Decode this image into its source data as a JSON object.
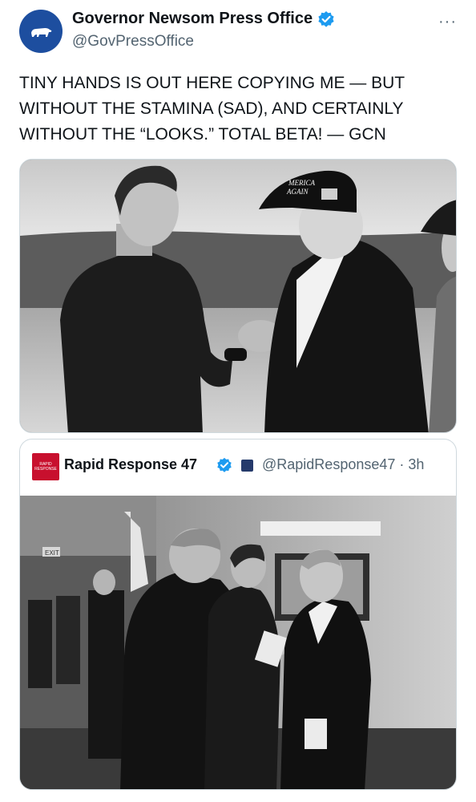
{
  "post": {
    "display_name": "Governor Newsom Press Office",
    "handle": "@GovPressOffice",
    "more_glyph": "···",
    "text": "TINY HANDS IS OUT HERE COPYING ME — BUT\nWITHOUT THE STAMINA (SAD), AND CERTAINLY\nWITHOUT THE “LOOKS.” TOTAL BETA! — GCN",
    "photo_hat_text": "MERICA\nAGAIN"
  },
  "quote": {
    "avatar_text": "RAPID\nRESPONSE",
    "display_name": "Rapid Response 47",
    "handle_time": "@RapidResponse47 · 3h",
    "exit_sign": "EXIT"
  },
  "colors": {
    "verified": "#1d9bf0",
    "avatar_bg": "#1d4e9f",
    "quote_avatar_bg": "#c8102e",
    "text_primary": "#0f1419",
    "text_secondary": "#536471"
  },
  "icons": {
    "verified": "verified-badge-icon",
    "more": "more-options-icon",
    "bear": "bear-logo-icon",
    "flag": "flag-icon"
  }
}
